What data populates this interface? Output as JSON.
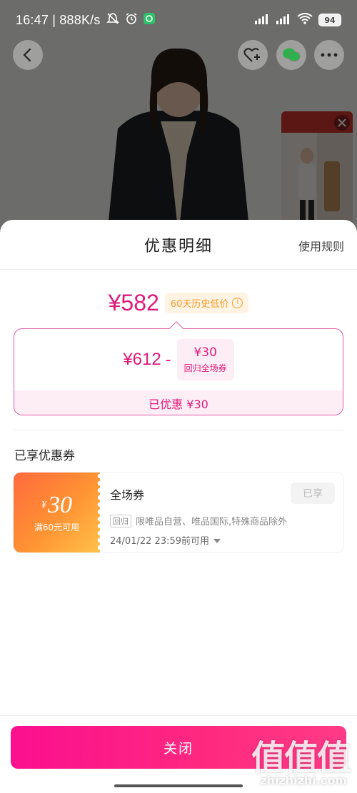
{
  "status_bar": {
    "time": "16:47 | 888K/s",
    "battery": "94"
  },
  "sheet": {
    "title": "优惠明细",
    "rules_link": "使用规则",
    "final_price": "¥582",
    "low_price_badge": "60天历史低价",
    "original_price": "¥612",
    "minus_sign": "-",
    "coupon_amount": "¥30",
    "coupon_type_label": "回归全场券",
    "discount_summary": "已优惠 ¥30",
    "section_title": "已享优惠券",
    "coupon": {
      "currency": "¥",
      "value": "30",
      "condition": "满60元可用",
      "name": "全场券",
      "status_button": "已享",
      "tag": "回归",
      "description": "限唯品自营、唯品国际,特殊商品除外",
      "expiry": "24/01/22 23:59前可用"
    },
    "close_button": "关闭"
  },
  "watermark": {
    "text": "值值值",
    "url": "zhizhizhi.com"
  },
  "colors": {
    "accent": "#e01a7a",
    "button_start": "#fb0f8f",
    "coupon_orange": "#ff8a33",
    "badge_orange": "#f39a28"
  }
}
